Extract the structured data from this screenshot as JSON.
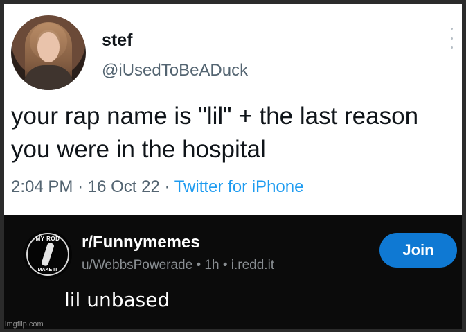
{
  "tweet": {
    "display_name": "stef",
    "handle": "@iUsedToBeADuck",
    "text": "your rap name is \"lil\" + the last reason you were in the hospital",
    "time": "2:04 PM",
    "date": "16 Oct 22",
    "separator": "·",
    "source": "Twitter for iPhone",
    "more_icon": "more-vertical-icon"
  },
  "reddit": {
    "subreddit": "r/Funnymemes",
    "icon_text_top": "MY ROD",
    "icon_text_bottom": "MAKE IT",
    "user": "u/WebbsPowerade",
    "dot": "•",
    "age": "1h",
    "domain": "i.redd.it",
    "join_label": "Join",
    "join_color": "#0f79d3",
    "post_title": "lil unbased"
  },
  "watermark": "imgflip.com",
  "colors": {
    "link_blue": "#1d9bf0",
    "muted": "#536471"
  }
}
